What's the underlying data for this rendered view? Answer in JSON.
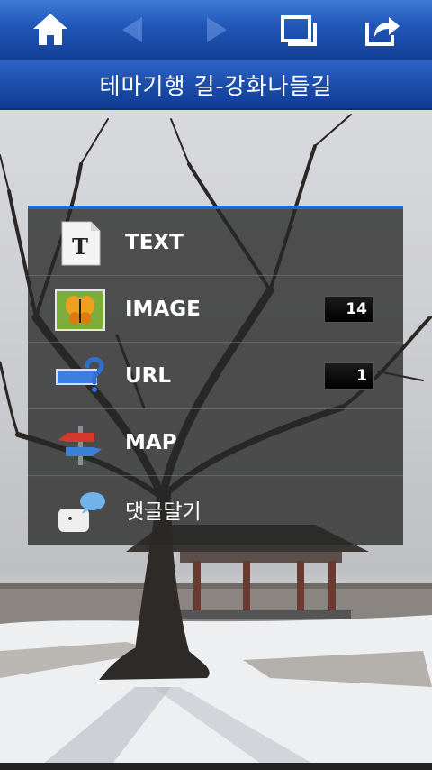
{
  "page": {
    "title": "테마기행 길-강화나들길"
  },
  "toolbar": {
    "buttons": [
      {
        "icon": "home-icon",
        "enabled": true
      },
      {
        "icon": "back-arrow-icon",
        "enabled": false
      },
      {
        "icon": "forward-arrow-icon",
        "enabled": false
      },
      {
        "icon": "window-icon",
        "enabled": true
      },
      {
        "icon": "share-icon",
        "enabled": true
      }
    ]
  },
  "menu": {
    "accent": "#1d6ad2",
    "items": [
      {
        "label": "TEXT",
        "icon": "text-document-icon",
        "count": ""
      },
      {
        "label": "IMAGE",
        "icon": "butterfly-image-icon",
        "count": "14"
      },
      {
        "label": "URL",
        "icon": "url-link-icon",
        "count": "1"
      },
      {
        "label": "MAP",
        "icon": "signpost-map-icon",
        "count": ""
      },
      {
        "label": "댓글달기",
        "icon": "comment-bubble-icon",
        "count": ""
      }
    ]
  }
}
